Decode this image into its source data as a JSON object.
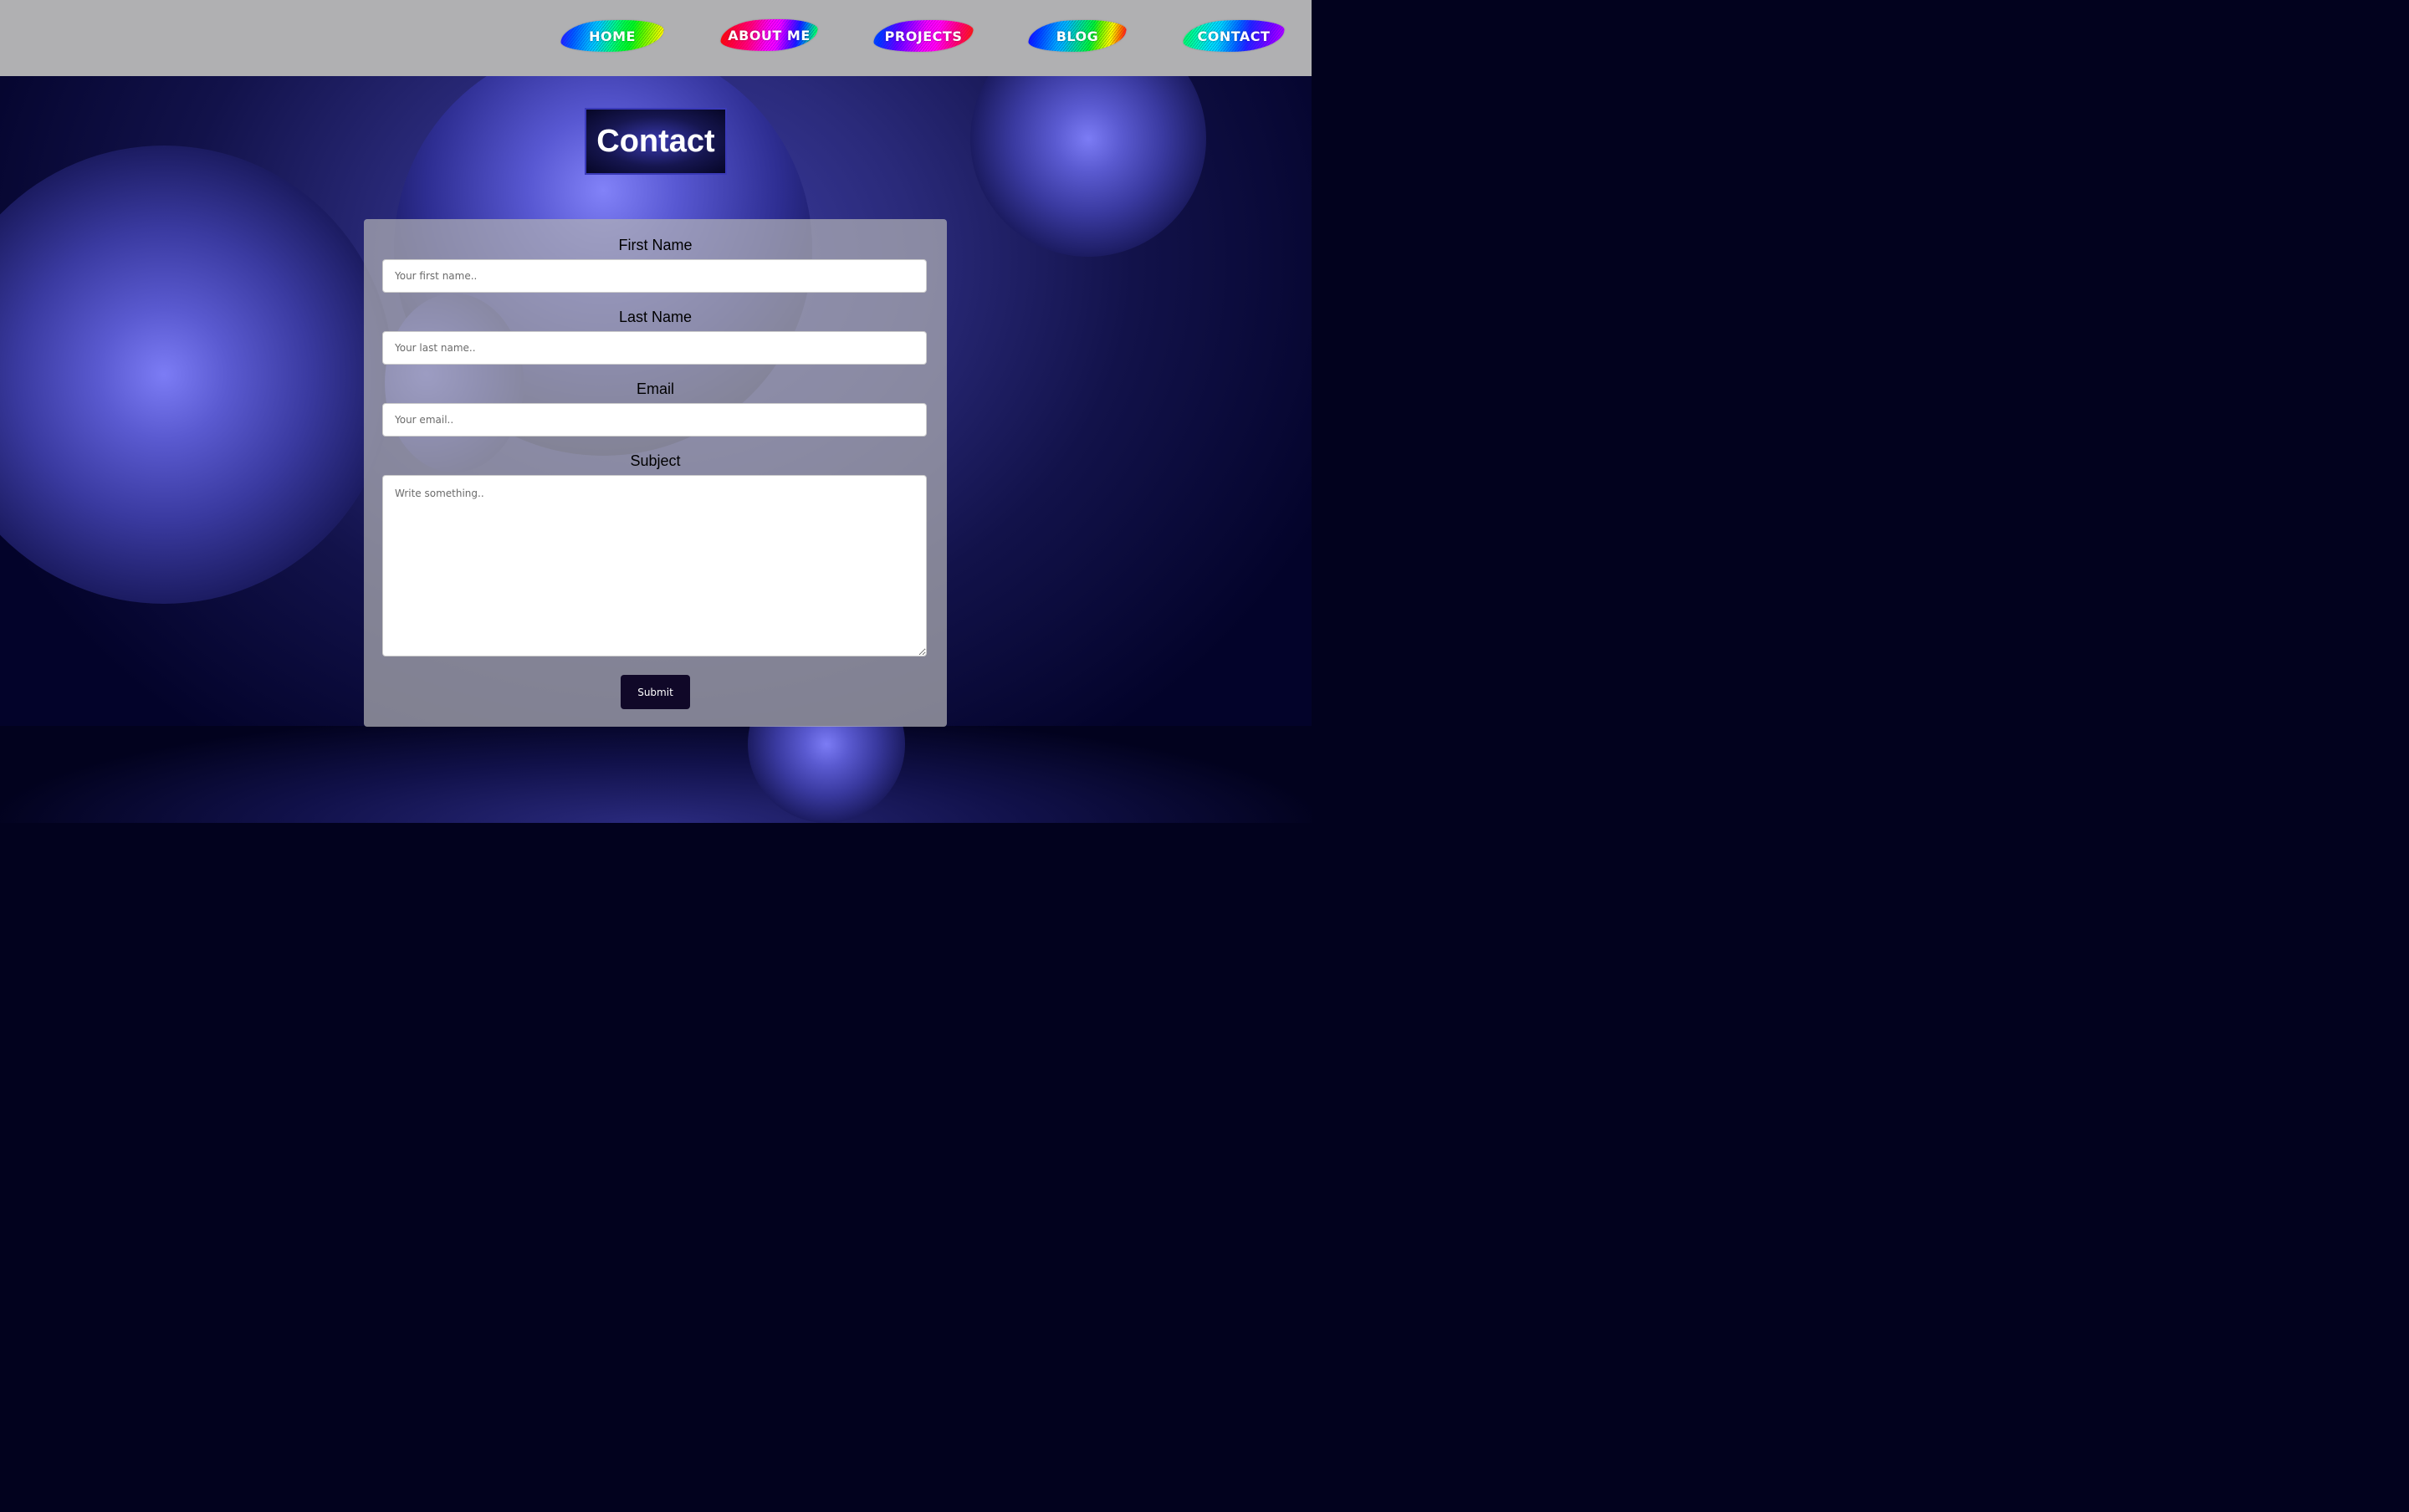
{
  "nav": {
    "items": [
      {
        "label": "HOME"
      },
      {
        "label": "ABOUT ME"
      },
      {
        "label": "PROJECTS"
      },
      {
        "label": "BLOG"
      },
      {
        "label": "CONTACT"
      }
    ]
  },
  "page": {
    "title": "Contact"
  },
  "form": {
    "first_name": {
      "label": "First Name",
      "placeholder": "Your first name.."
    },
    "last_name": {
      "label": "Last Name",
      "placeholder": "Your last name.."
    },
    "email": {
      "label": "Email",
      "placeholder": "Your email.."
    },
    "subject": {
      "label": "Subject",
      "placeholder": "Write something.."
    },
    "submit_label": "Submit"
  },
  "colors": {
    "navbar_bg": "#b0b0b2",
    "background_dark": "#02021e",
    "sphere_light": "#7c7cf5",
    "button_bg": "#100828",
    "form_bg": "#b0b0b4"
  }
}
